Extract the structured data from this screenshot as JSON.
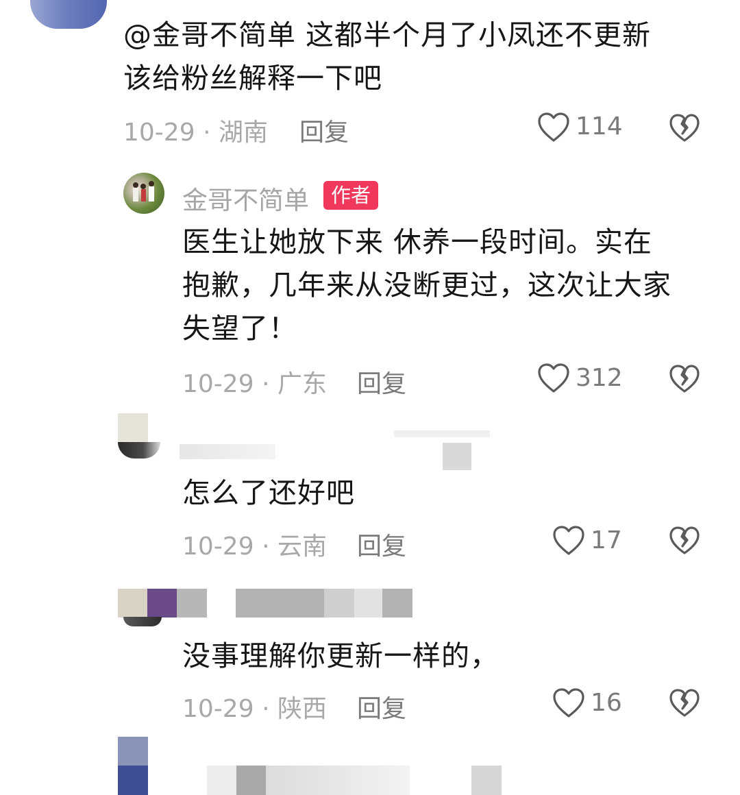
{
  "comments": [
    {
      "text_lines": [
        "@金哥不简单 这都半个月了小凤还不更新",
        "该给粉丝解释一下吧"
      ],
      "date": "10-29",
      "sep": "·",
      "location": "湖南",
      "reply_label": "回复",
      "likes": "114"
    },
    {
      "username": "金哥不简单",
      "badge": "作者",
      "text_lines": [
        "医生让她放下来 休养一段时间。实在",
        "抱歉，几年来从没断更过，这次让大家",
        "失望了！"
      ],
      "date": "10-29",
      "sep": "·",
      "location": "广东",
      "reply_label": "回复",
      "likes": "312"
    },
    {
      "text_lines": [
        "怎么了还好吧"
      ],
      "date": "10-29",
      "sep": "·",
      "location": "云南",
      "reply_label": "回复",
      "likes": "17"
    },
    {
      "text_lines": [
        "没事理解你更新一样的，"
      ],
      "date": "10-29",
      "sep": "·",
      "location": "陕西",
      "reply_label": "回复",
      "likes": "16"
    }
  ],
  "icons": {
    "like": "heart-outline-icon",
    "dislike": "broken-heart-icon"
  },
  "colors": {
    "badge": "#f0385c",
    "meta_text": "#a8a8a8",
    "body_text": "#161616"
  }
}
